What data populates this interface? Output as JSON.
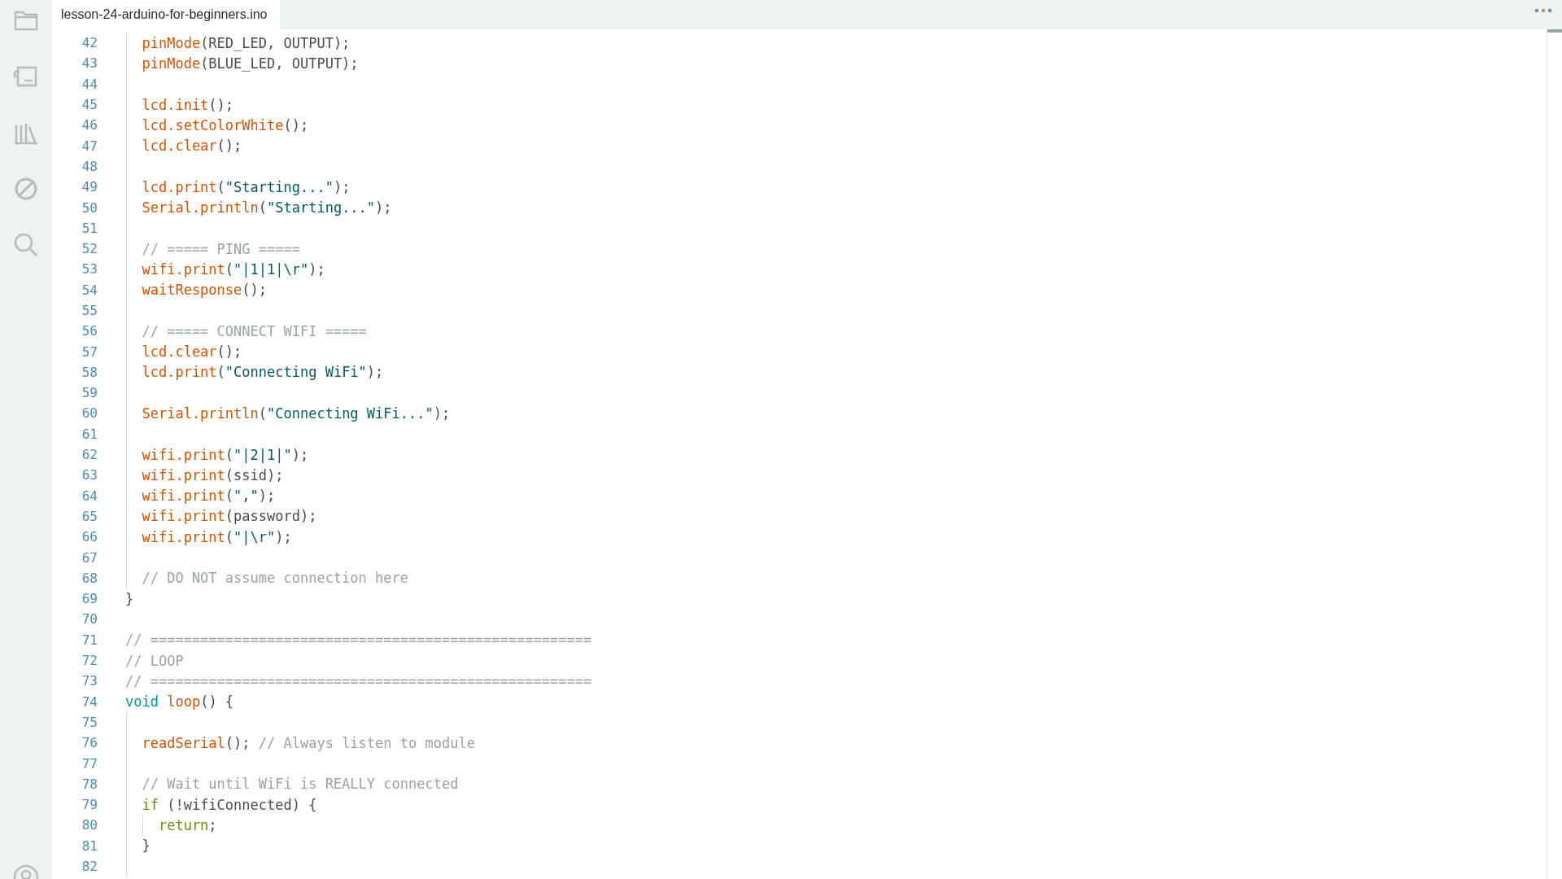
{
  "tabs": [
    {
      "label": "lesson-24-arduino-for-beginners.ino",
      "selected": true
    }
  ],
  "lines": [
    {
      "number": "42",
      "tokens": [
        {
          "kind": "fn",
          "text": "  pinMode"
        },
        {
          "kind": "plain",
          "text": "(RED_LED, OUTPUT);"
        }
      ]
    },
    {
      "number": "43",
      "tokens": [
        {
          "kind": "fn",
          "text": "  pinMode"
        },
        {
          "kind": "plain",
          "text": "(BLUE_LED, OUTPUT);"
        }
      ]
    },
    {
      "number": "44"
    },
    {
      "number": "45",
      "tokens": [
        {
          "kind": "fn",
          "text": "  lcd.init"
        },
        {
          "kind": "plain",
          "text": "();"
        }
      ]
    },
    {
      "number": "46",
      "tokens": [
        {
          "kind": "fn",
          "text": "  lcd.setColorWhite"
        },
        {
          "kind": "plain",
          "text": "();"
        }
      ]
    },
    {
      "number": "47",
      "tokens": [
        {
          "kind": "fn",
          "text": "  lcd.clear"
        },
        {
          "kind": "plain",
          "text": "();"
        }
      ]
    },
    {
      "number": "48"
    },
    {
      "number": "49",
      "tokens": [
        {
          "kind": "fn",
          "text": "  lcd.print"
        },
        {
          "kind": "plain",
          "text": "("
        },
        {
          "kind": "string",
          "text": "\"Starting...\""
        },
        {
          "kind": "plain",
          "text": ");"
        }
      ]
    },
    {
      "number": "50",
      "tokens": [
        {
          "kind": "fn",
          "text": "  Serial.println"
        },
        {
          "kind": "plain",
          "text": "("
        },
        {
          "kind": "string",
          "text": "\"Starting...\""
        },
        {
          "kind": "plain",
          "text": ");"
        }
      ]
    },
    {
      "number": "51"
    },
    {
      "number": "52",
      "tokens": [
        {
          "kind": "comment",
          "text": "  // ===== PING ====="
        }
      ]
    },
    {
      "number": "53",
      "tokens": [
        {
          "kind": "fn",
          "text": "  wifi.print"
        },
        {
          "kind": "plain",
          "text": "("
        },
        {
          "kind": "string",
          "text": "\"|1|1|\\r\""
        },
        {
          "kind": "plain",
          "text": ");"
        }
      ]
    },
    {
      "number": "54",
      "tokens": [
        {
          "kind": "fn",
          "text": "  waitResponse"
        },
        {
          "kind": "plain",
          "text": "();"
        }
      ]
    },
    {
      "number": "55"
    },
    {
      "number": "56",
      "tokens": [
        {
          "kind": "comment",
          "text": "  // ===== CONNECT WIFI ====="
        }
      ]
    },
    {
      "number": "57",
      "tokens": [
        {
          "kind": "fn",
          "text": "  lcd.clear"
        },
        {
          "kind": "plain",
          "text": "();"
        }
      ]
    },
    {
      "number": "58",
      "tokens": [
        {
          "kind": "fn",
          "text": "  lcd.print"
        },
        {
          "kind": "plain",
          "text": "("
        },
        {
          "kind": "string",
          "text": "\"Connecting WiFi\""
        },
        {
          "kind": "plain",
          "text": ");"
        }
      ]
    },
    {
      "number": "59"
    },
    {
      "number": "60",
      "tokens": [
        {
          "kind": "fn",
          "text": "  Serial.println"
        },
        {
          "kind": "plain",
          "text": "("
        },
        {
          "kind": "string",
          "text": "\"Connecting WiFi...\""
        },
        {
          "kind": "plain",
          "text": ");"
        }
      ]
    },
    {
      "number": "61"
    },
    {
      "number": "62",
      "tokens": [
        {
          "kind": "fn",
          "text": "  wifi.print"
        },
        {
          "kind": "plain",
          "text": "("
        },
        {
          "kind": "string",
          "text": "\"|2|1|\""
        },
        {
          "kind": "plain",
          "text": ");"
        }
      ]
    },
    {
      "number": "63",
      "tokens": [
        {
          "kind": "fn",
          "text": "  wifi.print"
        },
        {
          "kind": "plain",
          "text": "(ssid);"
        }
      ]
    },
    {
      "number": "64",
      "tokens": [
        {
          "kind": "fn",
          "text": "  wifi.print"
        },
        {
          "kind": "plain",
          "text": "("
        },
        {
          "kind": "string",
          "text": "\",\""
        },
        {
          "kind": "plain",
          "text": ");"
        }
      ]
    },
    {
      "number": "65",
      "tokens": [
        {
          "kind": "fn",
          "text": "  wifi.print"
        },
        {
          "kind": "plain",
          "text": "(password);"
        }
      ]
    },
    {
      "number": "66",
      "tokens": [
        {
          "kind": "fn",
          "text": "  wifi.print"
        },
        {
          "kind": "plain",
          "text": "("
        },
        {
          "kind": "string",
          "text": "\"|\\r\""
        },
        {
          "kind": "plain",
          "text": ");"
        }
      ]
    },
    {
      "number": "67"
    },
    {
      "number": "68",
      "tokens": [
        {
          "kind": "comment",
          "text": "  // DO NOT assume connection here"
        }
      ]
    },
    {
      "number": "69",
      "tokens": [
        {
          "kind": "plain",
          "text": "}"
        }
      ]
    },
    {
      "number": "70"
    },
    {
      "number": "71",
      "tokens": [
        {
          "kind": "comment",
          "text": "// ====================================================="
        }
      ]
    },
    {
      "number": "72",
      "tokens": [
        {
          "kind": "comment",
          "text": "// LOOP"
        }
      ]
    },
    {
      "number": "73",
      "tokens": [
        {
          "kind": "comment",
          "text": "// ====================================================="
        }
      ]
    },
    {
      "number": "74",
      "tokens": [
        {
          "kind": "keyword",
          "text": "void"
        },
        {
          "kind": "fn",
          "text": " loop"
        },
        {
          "kind": "plain",
          "text": "() {"
        }
      ]
    },
    {
      "number": "75"
    },
    {
      "number": "76",
      "tokens": [
        {
          "kind": "fn",
          "text": "  readSerial"
        },
        {
          "kind": "plain",
          "text": "(); "
        },
        {
          "kind": "comment",
          "text": "// Always listen to module"
        }
      ]
    },
    {
      "number": "77"
    },
    {
      "number": "78",
      "tokens": [
        {
          "kind": "comment",
          "text": "  // Wait until WiFi is REALLY connected"
        }
      ]
    },
    {
      "number": "79",
      "tokens": [
        {
          "kind": "control",
          "text": "  if"
        },
        {
          "kind": "plain",
          "text": " (!wifiConnected) {"
        }
      ]
    },
    {
      "number": "80",
      "tokens": [
        {
          "kind": "control",
          "text": "    return"
        },
        {
          "kind": "plain",
          "text": ";"
        }
      ]
    },
    {
      "number": "81",
      "tokens": [
        {
          "kind": "plain",
          "text": "  }"
        }
      ]
    },
    {
      "number": "82"
    }
  ]
}
